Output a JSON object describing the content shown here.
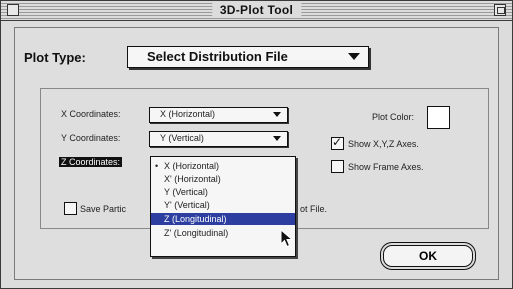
{
  "window": {
    "title": "3D-Plot Tool"
  },
  "plot_type": {
    "label": "Plot Type:",
    "value": "Select Distribution File"
  },
  "coords": {
    "x_label": "X Coordinates:",
    "x_value": "X (Horizontal)",
    "y_label": "Y Coordinates:",
    "y_value": "Y (Vertical)",
    "z_label": "Z Coordinates:"
  },
  "options": {
    "plot_color_label": "Plot Color:",
    "show_xyz_label": "Show X,Y,Z Axes.",
    "show_xyz_checked": true,
    "show_frame_label": "Show Frame Axes.",
    "show_frame_checked": false,
    "save_label_left": "Save Partic",
    "save_label_right": "ot File."
  },
  "z_menu": {
    "bullet": "•",
    "items": [
      "X (Horizontal)",
      "X' (Horizontal)",
      "Y (Vertical)",
      "Y' (Vertical)",
      "Z (Longitudinal)",
      "Z' (Longitudinal)"
    ],
    "selected_index": 0,
    "highlighted_index": 4
  },
  "buttons": {
    "ok": "OK"
  }
}
